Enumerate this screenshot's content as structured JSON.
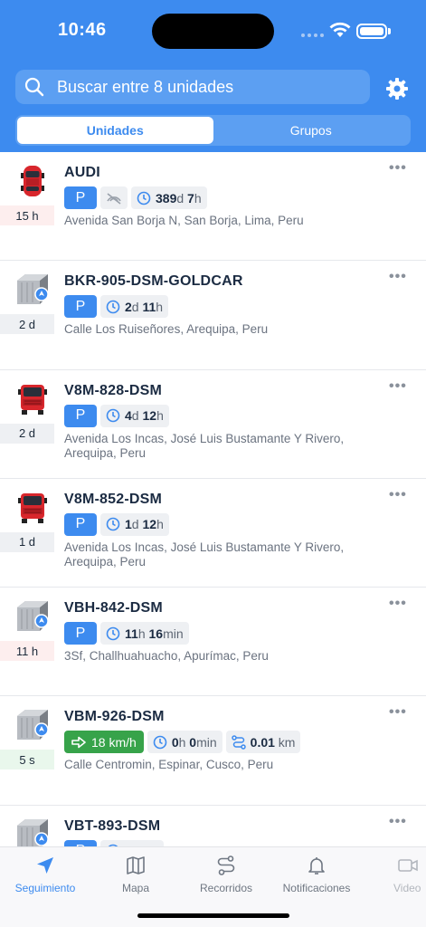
{
  "status": {
    "time": "10:46"
  },
  "search": {
    "placeholder": "Buscar entre 8 unidades"
  },
  "tabs": [
    {
      "label": "Unidades",
      "active": true
    },
    {
      "label": "Grupos",
      "active": false
    }
  ],
  "units": [
    {
      "name": "AUDI",
      "icon": "car-red-icon",
      "age": "15 h",
      "age_status": "red",
      "state": "P",
      "no_signal": true,
      "duration": {
        "d": "389",
        "d_unit": "d",
        "h": "7",
        "h_unit": "h"
      },
      "address": "Avenida San Borja N, San Borja, Lima, Peru"
    },
    {
      "name": "BKR-905-DSM-GOLDCAR",
      "icon": "container-icon",
      "age": "2 d",
      "age_status": "gray",
      "state": "P",
      "duration": {
        "d": "2",
        "d_unit": "d",
        "h": "11",
        "h_unit": "h"
      },
      "address": "Calle Los Ruiseñores, Arequipa, Peru"
    },
    {
      "name": "V8M-828-DSM",
      "icon": "truck-red-icon",
      "age": "2 d",
      "age_status": "gray",
      "state": "P",
      "duration": {
        "d": "4",
        "d_unit": "d",
        "h": "12",
        "h_unit": "h"
      },
      "address": "Avenida Los Incas, José Luis Bustamante Y Rivero, Arequipa, Peru"
    },
    {
      "name": "V8M-852-DSM",
      "icon": "truck-red-icon",
      "age": "1 d",
      "age_status": "gray",
      "state": "P",
      "duration": {
        "d": "1",
        "d_unit": "d",
        "h": "12",
        "h_unit": "h"
      },
      "address": "Avenida Los Incas, José Luis Bustamante Y Rivero, Arequipa, Peru"
    },
    {
      "name": "VBH-842-DSM",
      "icon": "container-icon",
      "age": "11 h",
      "age_status": "red",
      "state": "P",
      "duration": {
        "d": "11",
        "d_unit": "h",
        "h": "16",
        "h_unit": "min"
      },
      "address": "3Sf, Challhuahuacho, Apurímac, Peru"
    },
    {
      "name": "VBM-926-DSM",
      "icon": "container-icon",
      "age": "5 s",
      "age_status": "green",
      "speed": "18 km/h",
      "duration": {
        "d": "0",
        "d_unit": "h",
        "h": "0",
        "h_unit": "min"
      },
      "distance": {
        "value": "0.01",
        "unit": "km"
      },
      "address": "Calle Centromin, Espinar, Cusco, Peru"
    },
    {
      "name": "VBT-893-DSM",
      "icon": "container-icon",
      "age": "",
      "age_status": "gray",
      "state": "P",
      "duration": {
        "d": "",
        "d_unit": "",
        "h": "",
        "h_unit": ""
      },
      "address": ""
    }
  ],
  "tabbar": [
    {
      "label": "Seguimiento",
      "icon": "navigation-arrow-icon",
      "active": true
    },
    {
      "label": "Mapa",
      "icon": "map-icon",
      "active": false
    },
    {
      "label": "Recorridos",
      "icon": "route-icon",
      "active": false
    },
    {
      "label": "Notificaciones",
      "icon": "bell-icon",
      "active": false
    },
    {
      "label": "Video",
      "icon": "video-icon",
      "active": false
    }
  ],
  "colors": {
    "primary": "#3d8bef",
    "moving": "#37a34a",
    "stale": "#fdeeee"
  }
}
